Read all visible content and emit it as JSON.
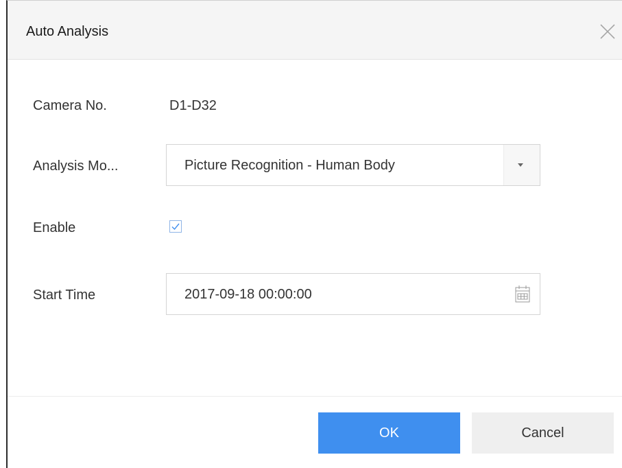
{
  "dialog": {
    "title": "Auto Analysis"
  },
  "form": {
    "camera_label": "Camera No.",
    "camera_value": "D1-D32",
    "mode_label": "Analysis Mo...",
    "mode_value": "Picture Recognition - Human Body",
    "enable_label": "Enable",
    "enable_checked": true,
    "start_time_label": "Start Time",
    "start_time_value": "2017-09-18 00:00:00"
  },
  "buttons": {
    "ok_label": "OK",
    "cancel_label": "Cancel"
  },
  "icons": {
    "close": "close-icon",
    "dropdown": "chevron-down-icon",
    "check": "check-icon",
    "calendar": "calendar-icon"
  },
  "colors": {
    "primary": "#3f8fef",
    "checkbox_border": "#8eb4e6",
    "header_bg": "#f5f5f5"
  }
}
